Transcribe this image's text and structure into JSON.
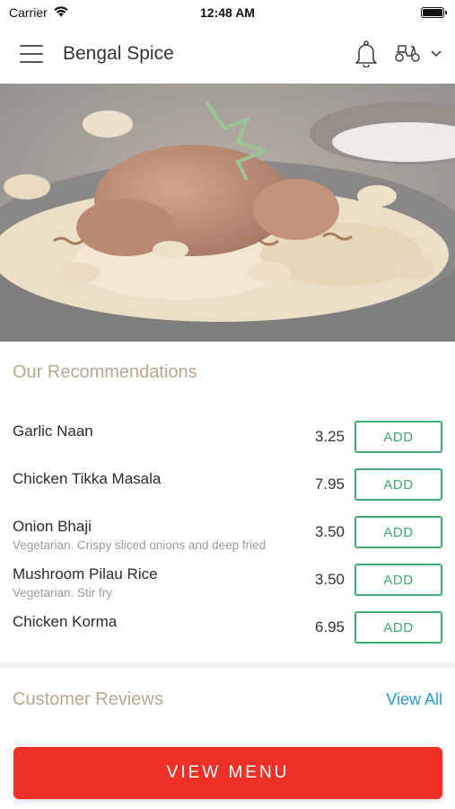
{
  "status_bar": {
    "carrier": "Carrier",
    "time": "12:48 AM"
  },
  "header": {
    "title": "Bengal Spice"
  },
  "icons": {
    "menu": "hamburger-menu-icon",
    "notification": "bell-icon",
    "delivery": "scooter-icon",
    "dropdown": "chevron-down-icon"
  },
  "recommendations": {
    "title": "Our Recommendations",
    "add_label": "ADD",
    "items": [
      {
        "name": "Garlic Naan",
        "description": "",
        "price": "3.25"
      },
      {
        "name": "Chicken Tikka Masala",
        "description": "",
        "price": "7.95"
      },
      {
        "name": "Onion Bhaji",
        "description": "Vegetarian. Crispy sliced onions and deep fried",
        "price": "3.50"
      },
      {
        "name": "Mushroom Pilau Rice",
        "description": "Vegetarian. Stir fry",
        "price": "3.50"
      },
      {
        "name": "Chicken Korma",
        "description": "",
        "price": "6.95"
      }
    ]
  },
  "reviews": {
    "title": "Customer Reviews",
    "view_all_label": "View All"
  },
  "view_menu_label": "VIEW MENU",
  "colors": {
    "accent_red": "#ee3026",
    "add_green": "#3daa6e",
    "link_blue": "#1e9bd6",
    "section_title": "#b8a88b"
  }
}
